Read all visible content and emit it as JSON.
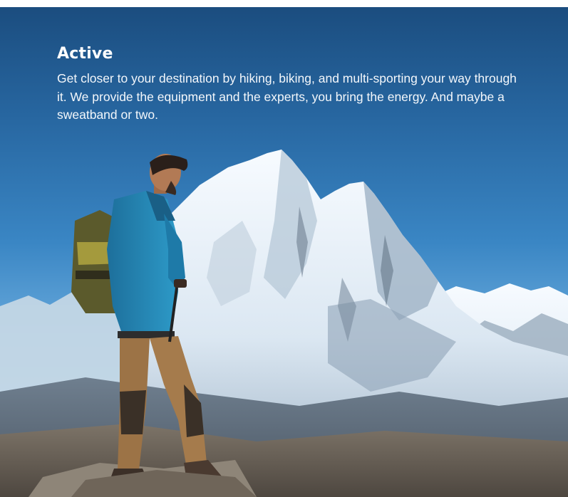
{
  "hero": {
    "title": "Active",
    "description": "Get closer to your destination by hiking, biking, and multi-sporting your way through it. We provide the equipment and the experts, you bring the energy. And maybe a sweatband or two.",
    "photo_subject": "hiker-overlooking-snow-mountains",
    "colors": {
      "sky_top": "#1b4d7f",
      "sky_bottom": "#9ccbee",
      "text": "#ffffff"
    }
  }
}
